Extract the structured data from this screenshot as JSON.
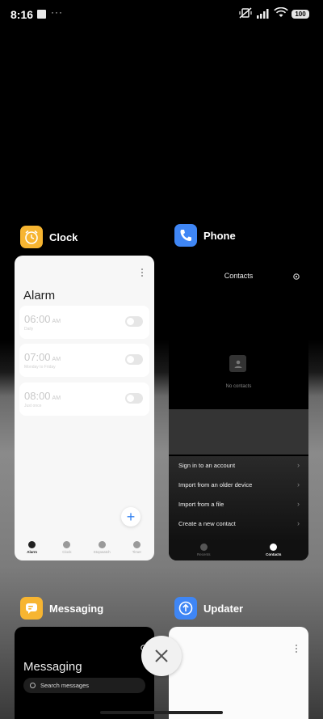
{
  "status_bar": {
    "time": "8:16",
    "more": "···",
    "battery": "100"
  },
  "clock": {
    "app_name": "Clock",
    "title": "Alarm",
    "alarms": [
      {
        "time": "06:00",
        "ampm": "AM",
        "sub": "Daily"
      },
      {
        "time": "07:00",
        "ampm": "AM",
        "sub": "Monday to Friday"
      },
      {
        "time": "08:00",
        "ampm": "AM",
        "sub": "Just once"
      }
    ],
    "nav": [
      "Alarm",
      "Clock",
      "Stopwatch",
      "Timer"
    ],
    "colors": {
      "icon_bg": "#f7b531",
      "accent": "#2f7ff0"
    }
  },
  "phone": {
    "app_name": "Phone",
    "title": "Contacts",
    "empty_text": "No contacts",
    "menu": [
      "Sign in to an account",
      "Import from an older device",
      "Import from a file",
      "Create a new contact"
    ],
    "nav": [
      "Recents",
      "Contacts"
    ],
    "colors": {
      "icon_bg": "#3f86f5"
    }
  },
  "messaging": {
    "app_name": "Messaging",
    "title": "Messaging",
    "search_placeholder": "Search messages",
    "colors": {
      "icon_bg": "#f7b531"
    }
  },
  "updater": {
    "app_name": "Updater",
    "colors": {
      "icon_bg": "#3f86f5"
    }
  }
}
